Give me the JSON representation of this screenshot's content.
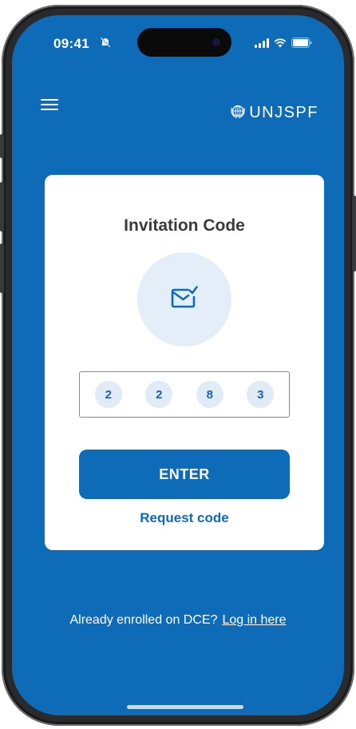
{
  "status_bar": {
    "time": "09:41",
    "icons": [
      "bell-slash-icon",
      "signal-icon",
      "wifi-icon",
      "battery-icon"
    ]
  },
  "header": {
    "menu_icon": "hamburger-menu-icon",
    "brand_icon": "un-emblem-icon",
    "brand_name": "UNJSPF"
  },
  "card": {
    "title": "Invitation Code",
    "illustration_icon": "mail-check-icon",
    "code_digits": [
      "2",
      "2",
      "8",
      "3"
    ],
    "enter_label": "ENTER",
    "request_label": "Request code"
  },
  "footer": {
    "prompt": "Already enrolled on DCE?",
    "login_label": "Log in here"
  },
  "colors": {
    "primary": "#0d6bb7",
    "card_bg": "#ffffff",
    "digit_bg": "#e0ebf6",
    "illustration_bg": "#e4eef8"
  }
}
